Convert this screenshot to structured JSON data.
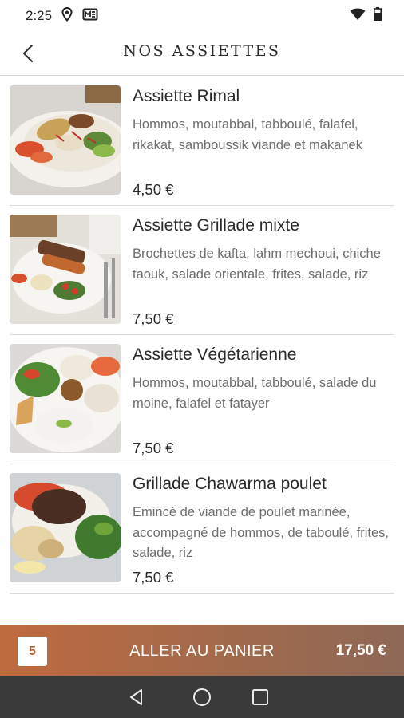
{
  "status_bar": {
    "time": "2:25",
    "icons": [
      "location-icon",
      "mail-icon",
      "wifi-icon",
      "battery-icon"
    ]
  },
  "header": {
    "title": "NOS ASSIETTES",
    "back_icon": "chevron-left-icon"
  },
  "dishes": [
    {
      "name": "Assiette Rimal",
      "description": "Hommos, moutabbal, tabboulé, falafel, rikakat, samboussik viande et makanek",
      "price": "4,50 €"
    },
    {
      "name": "Assiette Grillade mixte",
      "description": "Brochettes de kafta, lahm mechoui, chiche taouk, salade orientale, frites, salade, riz",
      "price": "7,50 €"
    },
    {
      "name": "Assiette Végétarienne",
      "description": "Hommos, moutabbal, tabboulé, salade du moine, falafel et fatayer",
      "price": "7,50 €"
    },
    {
      "name": "Grillade Chawarma poulet",
      "description": "Emincé de viande de poulet marinée, accompagné de hommos, de taboulé, frites, salade, riz",
      "price": "7,50 €"
    }
  ],
  "cart": {
    "count": "5",
    "label": "ALLER AU PANIER",
    "total": "17,50 €",
    "color": "#b8683f"
  },
  "nav_bar": {
    "icons": [
      "back-triangle-icon",
      "home-circle-icon",
      "recents-square-icon"
    ]
  }
}
